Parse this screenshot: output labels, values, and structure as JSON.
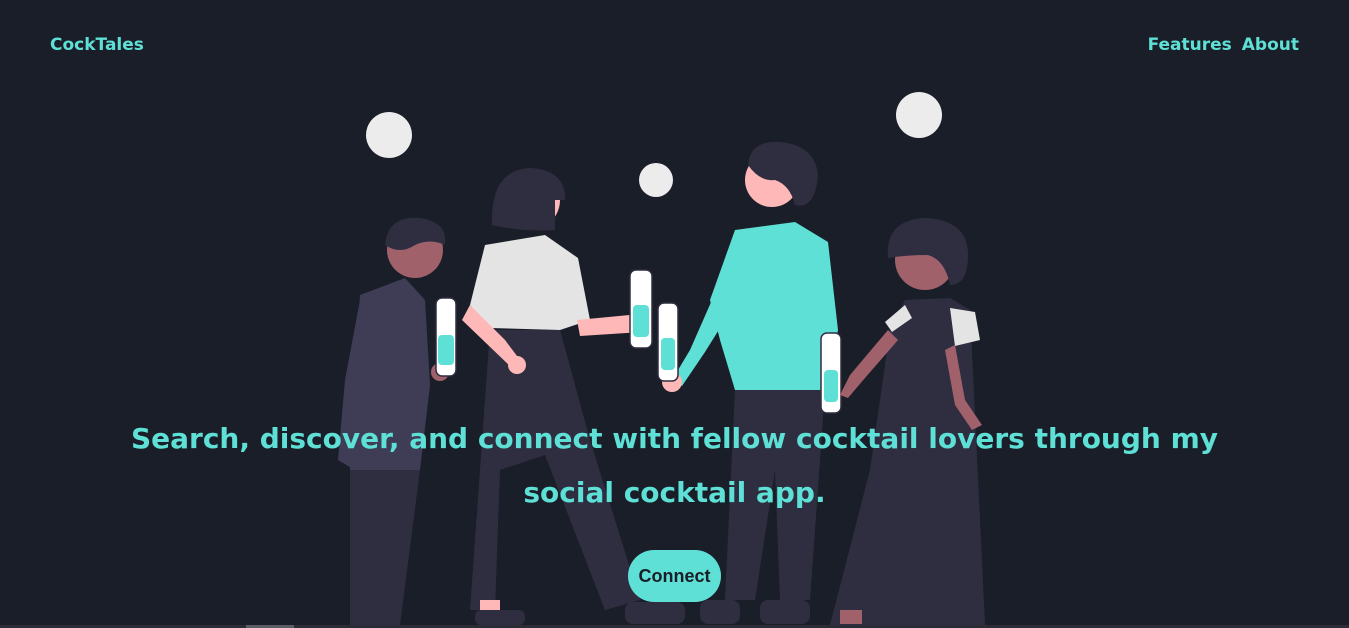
{
  "header": {
    "brand": "CockTales",
    "nav": [
      {
        "label": "Features"
      },
      {
        "label": "About"
      }
    ]
  },
  "hero": {
    "headline": "Search, discover, and connect with fellow cocktail lovers through my social cocktail app.",
    "cta_label": "Connect"
  },
  "illustration": {
    "name": "people-toasting-cocktails"
  },
  "colors": {
    "background": "#1a1e28",
    "accent": "#5ee0d6"
  }
}
